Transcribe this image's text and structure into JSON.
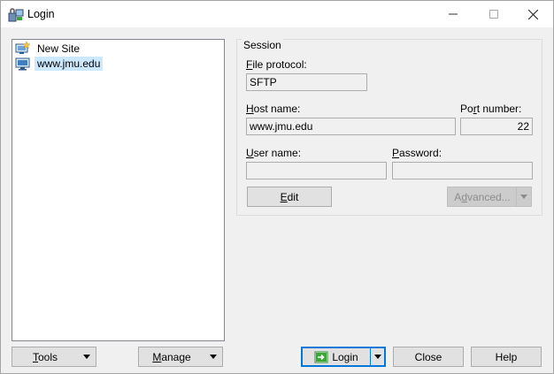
{
  "window": {
    "title": "Login"
  },
  "sites": [
    {
      "label": "New Site",
      "icon": "new-site-icon"
    },
    {
      "label": "www.jmu.edu",
      "icon": "site-computer-icon"
    }
  ],
  "session": {
    "legend": "Session",
    "file_protocol_label_u": "F",
    "file_protocol_label_rest": "ile protocol:",
    "file_protocol_value": "SFTP",
    "host_label_u": "H",
    "host_label_rest": "ost name:",
    "host_value": "www.jmu.edu",
    "port_label_pre": "Po",
    "port_label_u": "r",
    "port_label_rest": "t number:",
    "port_value": "22",
    "user_label_u": "U",
    "user_label_rest": "ser name:",
    "user_value": "",
    "password_label_u": "P",
    "password_label_rest": "assword:",
    "password_value": "",
    "edit_u": "E",
    "edit_rest": "dit",
    "advanced_pre": "A",
    "advanced_u": "d",
    "advanced_rest": "vanced..."
  },
  "buttons": {
    "tools_u": "T",
    "tools_rest": "ools",
    "manage_u": "M",
    "manage_rest": "anage",
    "login": "Login",
    "close": "Close",
    "help": "Help"
  },
  "colors": {
    "selection": "#cce8ff",
    "accent": "#0078d7",
    "login_icon": "#3aa63a"
  }
}
